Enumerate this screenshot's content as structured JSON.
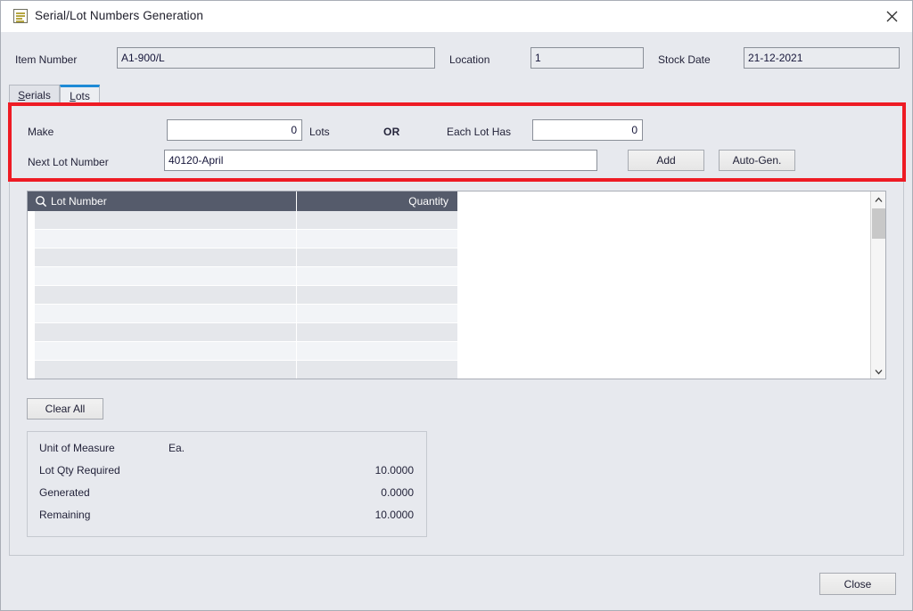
{
  "window": {
    "title": "Serial/Lot Numbers Generation",
    "icon": "document-list-icon",
    "close_icon": "close-icon"
  },
  "header": {
    "item_number_label": "Item Number",
    "item_number_value": "A1-900/L",
    "location_label": "Location",
    "location_value": "1",
    "stock_date_label": "Stock Date",
    "stock_date_value": "21-12-2021"
  },
  "tabs": [
    {
      "label": "Serials",
      "accelerator": "S",
      "rest": "erials",
      "active": false
    },
    {
      "label": "Lots",
      "accelerator": "L",
      "rest": "ots",
      "active": true
    }
  ],
  "generation": {
    "make_label": "Make",
    "make_value": "0",
    "lots_label": "Lots",
    "or_label": "OR",
    "each_lot_has_label": "Each Lot Has",
    "each_lot_has_value": "0",
    "next_lot_number_label": "Next Lot Number",
    "next_lot_number_value": "40120-April",
    "add_button": "Add",
    "autogen_button": "Auto-Gen.",
    "highlight_color": "#ee1b24"
  },
  "grid": {
    "search_icon": "search-icon",
    "columns": [
      {
        "label": "Lot Number",
        "align": "left"
      },
      {
        "label": "Quantity",
        "align": "right"
      }
    ],
    "rows": [],
    "empty_row_count": 9,
    "header_color": "#555b6b",
    "scrollbar": {
      "up_icon": "chevron-up-icon",
      "down_icon": "chevron-down-icon"
    }
  },
  "actions": {
    "clear_all": "Clear All",
    "close": "Close"
  },
  "summary": {
    "rows": [
      {
        "label": "Unit of Measure",
        "value": "Ea.",
        "align": "left"
      },
      {
        "label": "Lot Qty Required",
        "value": "10.0000",
        "align": "right"
      },
      {
        "label": "Generated",
        "value": "0.0000",
        "align": "right"
      },
      {
        "label": "Remaining",
        "value": "10.0000",
        "align": "right"
      }
    ]
  }
}
